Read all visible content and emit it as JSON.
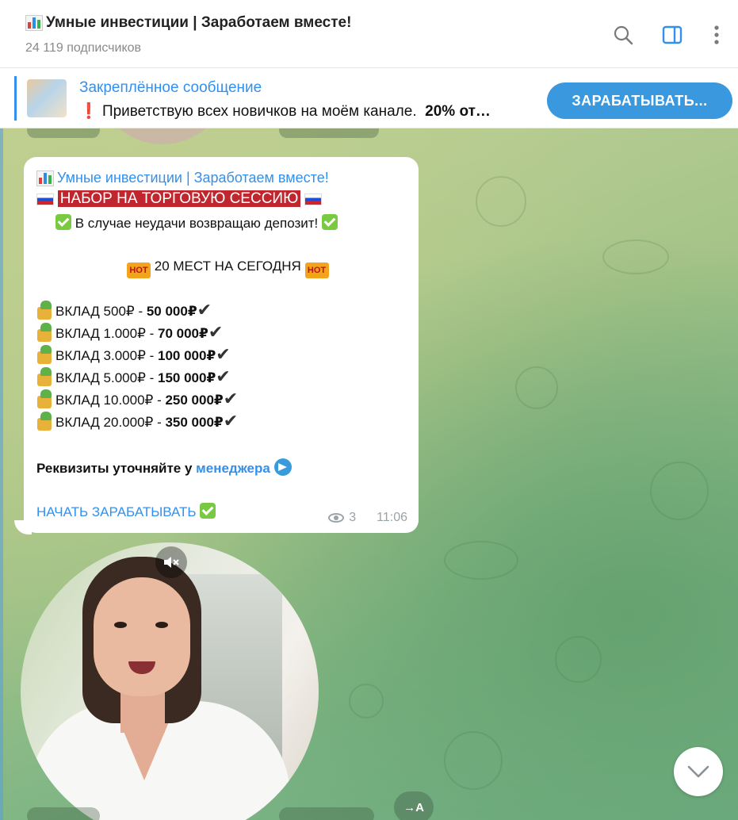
{
  "header": {
    "channel_title": "Умные инвестиции | Заработаем вместе!",
    "subscribers": "24 119 подписчиков",
    "icons": [
      "search-icon",
      "sidebar-toggle-icon",
      "more-vertical-icon"
    ]
  },
  "pinned": {
    "title": "Закреплённое сообщение",
    "text_prefix": "Приветствую всех новичков на моём канале.",
    "text_bold": "20% от…",
    "button_label": "ЗАРАБАТЫВАТЬ..."
  },
  "message": {
    "sender": "Умные инвестиции | Заработаем вместе!",
    "headline": "НАБОР НА ТОРГОВУЮ СЕССИЮ",
    "guarantee": "В случае неудачи возвращаю депозит!",
    "hot_label": "HOT",
    "places": "20 МЕСТ НА СЕГОДНЯ",
    "offers": [
      {
        "deposit": "ВКЛАД 500₽ - ",
        "payout": "50 000₽"
      },
      {
        "deposit": "ВКЛАД 1.000₽ - ",
        "payout": "70 000₽"
      },
      {
        "deposit": "ВКЛАД 3.000₽ - ",
        "payout": "100 000₽"
      },
      {
        "deposit": "ВКЛАД 5.000₽ - ",
        "payout": "150 000₽"
      },
      {
        "deposit": "ВКЛАД 10.000₽ - ",
        "payout": "250 000₽"
      },
      {
        "deposit": "ВКЛАД 20.000₽ - ",
        "payout": "350 000₽"
      }
    ],
    "details_prefix": "Реквизиты уточняйте у ",
    "details_link": "менеджера",
    "cta_link": "НАЧАТЬ ЗАРАБАТЫВАТЬ",
    "views": "3",
    "time": "11:06"
  },
  "video": {
    "muted_icon": "mute-icon"
  },
  "bottom": {
    "share_label": "→A"
  },
  "colors": {
    "accent": "#3390ec",
    "button": "#3a98de",
    "headline_bg": "#c0262d",
    "check_green": "#7ac943"
  }
}
